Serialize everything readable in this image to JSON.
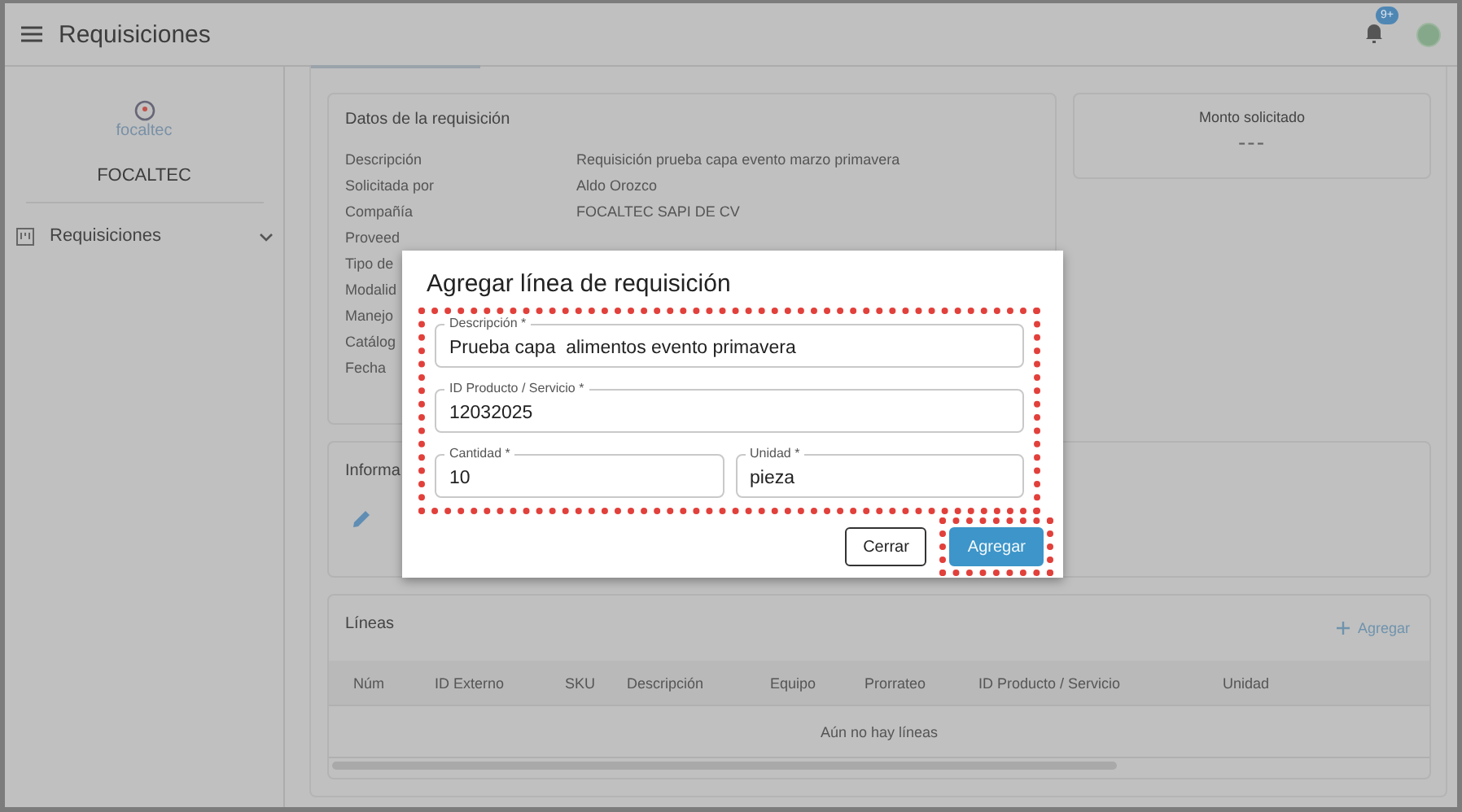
{
  "app_bar": {
    "title": "Requisiciones",
    "notification_badge": "9+"
  },
  "sidebar": {
    "logo_text": "focaltec",
    "company": "FOCALTEC",
    "items": [
      {
        "label": "Requisiciones",
        "expanded": false
      }
    ]
  },
  "details_card": {
    "title": "Datos de la requisición",
    "rows": [
      {
        "label": "Descripción",
        "value": "Requisición prueba capa evento marzo primavera"
      },
      {
        "label": "Solicitada por",
        "value": "Aldo Orozco"
      },
      {
        "label": "Compañía",
        "value": "FOCALTEC SAPI DE CV"
      },
      {
        "label": "Proveed"
      },
      {
        "label": "Tipo de"
      },
      {
        "label": "Modalid"
      },
      {
        "label": "Manejo"
      },
      {
        "label": "Catálog"
      },
      {
        "label": "Fecha"
      }
    ]
  },
  "amount_card": {
    "title": "Monto solicitado",
    "value": "---"
  },
  "info_card": {
    "title": "Informa"
  },
  "lines_card": {
    "title": "Líneas",
    "add_button": "Agregar",
    "columns": [
      "Núm",
      "ID Externo",
      "SKU",
      "Descripción",
      "Equipo",
      "Prorrateo",
      "ID Producto / Servicio",
      "Unidad"
    ],
    "empty_text": "Aún no hay líneas"
  },
  "dialog": {
    "title": "Agregar línea de requisición",
    "highlighted": true,
    "field_rows": [
      [
        {
          "label": "Descripción *",
          "value": "Prueba capa  alimentos evento primavera"
        }
      ],
      [
        {
          "label": "ID Producto / Servicio *",
          "value": "12032025"
        }
      ],
      [
        {
          "label": "Cantidad *",
          "value": "10"
        },
        {
          "label": "Unidad *",
          "value": "pieza"
        }
      ]
    ],
    "buttons": [
      {
        "label": "Cerrar",
        "kind": "outlined"
      },
      {
        "label": "Agregar",
        "kind": "primary",
        "highlighted": true
      }
    ]
  }
}
